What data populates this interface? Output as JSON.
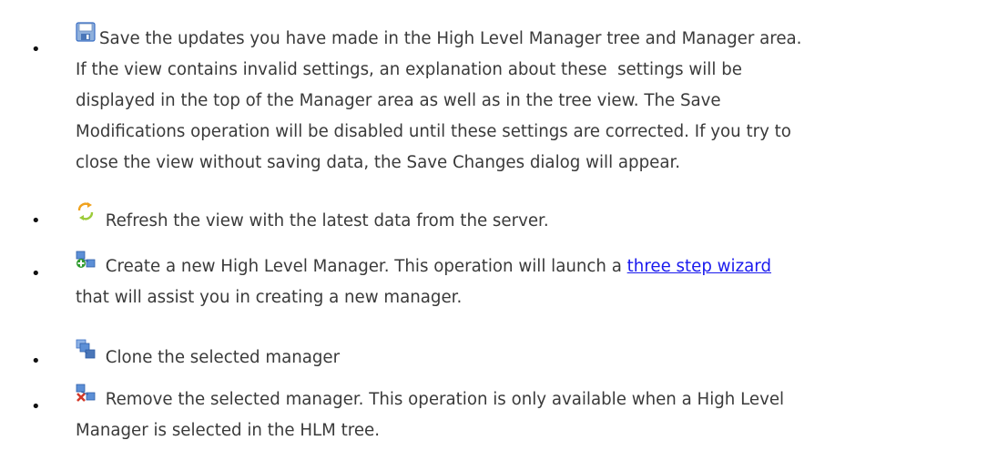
{
  "items": [
    {
      "icon": "save-disk-icon",
      "text": "Save the updates you have made in the High Level Manager tree and Manager area. If the view contains invalid settings, an explanation about these  settings will be displayed in the top of the Manager area as well as in the tree view. The Save Modifications operation will be disabled until these settings are corrected. If you try to close the view without saving data, the Save Changes dialog will appear."
    },
    {
      "icon": "refresh-arrows-icon",
      "text": "Refresh the view with the latest data from the server."
    },
    {
      "icon": "new-manager-icon",
      "text_before": "Create a new High Level Manager. This operation will launch a ",
      "link": "three step wizard",
      "text_after": " that will assist you in creating a new manager."
    },
    {
      "icon": "clone-manager-icon",
      "text": "Clone the selected manager"
    },
    {
      "icon": "remove-manager-icon",
      "text": "Remove the selected manager. This operation is only available when a High Level Manager is selected in the HLM tree."
    }
  ],
  "colors": {
    "text": "#3a3a3a",
    "link": "#1a1aee",
    "icon_blue": "#3b6fc4",
    "icon_green": "#2e9a2e",
    "icon_red": "#d23a2a",
    "icon_orange": "#f0a21e"
  }
}
